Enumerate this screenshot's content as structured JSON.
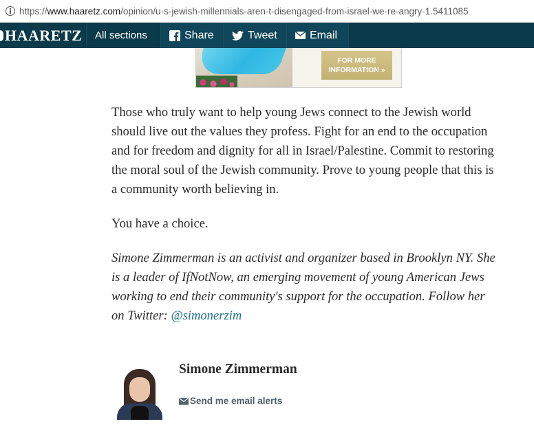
{
  "browser": {
    "url_prefix": "https://",
    "url_host": "www.haaretz.com",
    "url_path": "/opinion/u-s-jewish-millennials-aren-t-disengaged-from-israel-we-re-angry-1.5411085"
  },
  "nav": {
    "logo": "HAARETZ",
    "all_sections": "All sections",
    "share": "Share",
    "tweet": "Tweet",
    "email": "Email"
  },
  "ad": {
    "button_line1": "FOR MORE",
    "button_line2": "INFORMATION »"
  },
  "article": {
    "paragraphs": [
      "Those who truly want to help young Jews connect to the Jewish world should live out the values they profess. Fight for an end to the occupation and for freedom and dignity for all in Israel/Palestine. Commit to restoring the moral soul of the Jewish community. Prove to young people that this is a community worth believing in.",
      "You have a choice."
    ],
    "bio_text": "Simone Zimmerman is an activist and organizer based in Brooklyn NY. She is a leader of IfNotNow, an emerging movement of young American Jews working to end their community's support for the occupation. Follow her on Twitter: ",
    "bio_link": "@simonerzim"
  },
  "author": {
    "name": "Simone Zimmerman",
    "alerts_label": "Send me email alerts"
  },
  "colors": {
    "nav_bg": "#0b3a4a",
    "link": "#1a6e86",
    "ad_gold": "#c9b87a"
  },
  "icons": {
    "url_bar": "info-icon",
    "share": "facebook-icon",
    "tweet": "twitter-icon",
    "email": "envelope-icon",
    "alerts": "mail-icon"
  }
}
